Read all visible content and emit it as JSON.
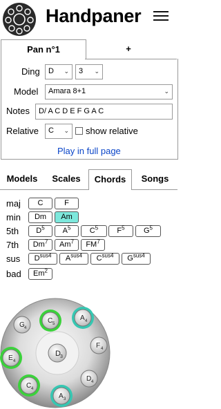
{
  "header": {
    "title": "Handpaner",
    "menu_icon": "hamburger-icon",
    "logo_icon": "handpan-logo-icon"
  },
  "pan_tabs": [
    {
      "label": "Pan n°1",
      "active": true
    },
    {
      "label": "+",
      "active": false
    }
  ],
  "form": {
    "ding_label": "Ding",
    "ding_note": "D",
    "ding_octave": "3",
    "model_label": "Model",
    "model_value": "Amara 8+1",
    "notes_label": "Notes",
    "notes_value": "D/ A C D E F G A C",
    "relative_label": "Relative",
    "relative_value": "C",
    "show_relative_label": "show relative",
    "show_relative_checked": false,
    "play_link": "Play in full page"
  },
  "category_tabs": [
    {
      "label": "Models",
      "active": false
    },
    {
      "label": "Scales",
      "active": false
    },
    {
      "label": "Chords",
      "active": true
    },
    {
      "label": "Songs",
      "active": false
    }
  ],
  "chords": {
    "maj": {
      "label": "maj",
      "items": [
        "C",
        "F"
      ]
    },
    "min": {
      "label": "min",
      "items": [
        "Dm",
        "Am"
      ]
    },
    "fifth": {
      "label": "5th",
      "items": [
        "D",
        "A",
        "C",
        "F",
        "G"
      ],
      "sup": "5"
    },
    "seventh": {
      "label": "7th",
      "items": [
        "Dm",
        "Am",
        "FM"
      ],
      "sup": "7"
    },
    "sus": {
      "label": "sus",
      "items": [
        "D",
        "A",
        "C",
        "G"
      ],
      "sup": "sus4"
    },
    "bad": {
      "label": "bad",
      "items": [
        "Em"
      ],
      "sup": "2"
    },
    "selected": "Am",
    "highlight_color": "#7de8dc"
  },
  "handpan": {
    "ding": {
      "note": "D",
      "octave": "3"
    },
    "notes": [
      {
        "note": "C",
        "octave": "5",
        "ring": "green"
      },
      {
        "note": "A",
        "octave": "4",
        "ring": "teal"
      },
      {
        "note": "G",
        "octave": "4",
        "ring": "none"
      },
      {
        "note": "F",
        "octave": "4",
        "ring": "none"
      },
      {
        "note": "E",
        "octave": "4",
        "ring": "green"
      },
      {
        "note": "D",
        "octave": "4",
        "ring": "none"
      },
      {
        "note": "C",
        "octave": "4",
        "ring": "green"
      },
      {
        "note": "A",
        "octave": "3",
        "ring": "teal"
      }
    ],
    "colors": {
      "green": "#3bd23b",
      "teal": "#36c7b2"
    }
  }
}
